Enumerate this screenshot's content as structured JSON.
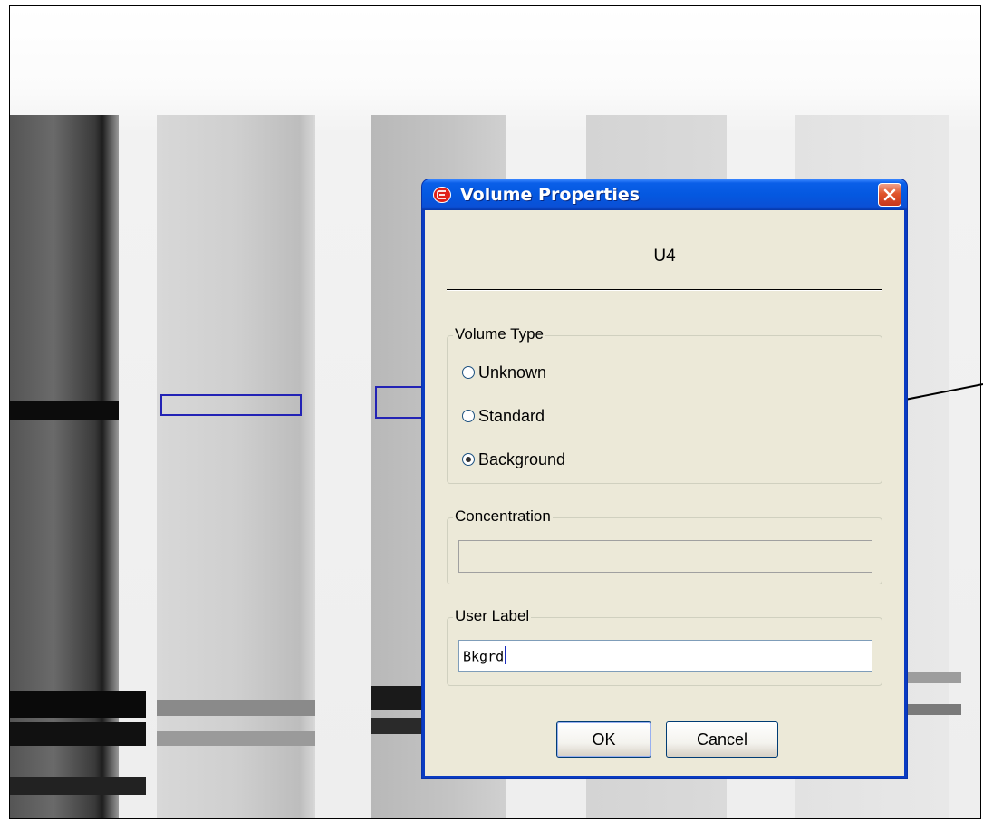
{
  "dialog": {
    "title": "Volume Properties",
    "volume_name": "U4",
    "volume_type": {
      "legend": "Volume Type",
      "options": [
        {
          "label": "Unknown",
          "selected": false
        },
        {
          "label": "Standard",
          "selected": false
        },
        {
          "label": "Background",
          "selected": true
        }
      ]
    },
    "concentration": {
      "legend": "Concentration",
      "value": ""
    },
    "user_label": {
      "legend": "User Label",
      "value": "Bkgrd"
    },
    "buttons": {
      "ok": "OK",
      "cancel": "Cancel"
    }
  },
  "icons": {
    "title": "app-icon",
    "close": "close-icon"
  },
  "colors": {
    "selection_box": "#2323b5",
    "titlebar": "#0458e0",
    "dialog_bg": "#ece9d8"
  }
}
